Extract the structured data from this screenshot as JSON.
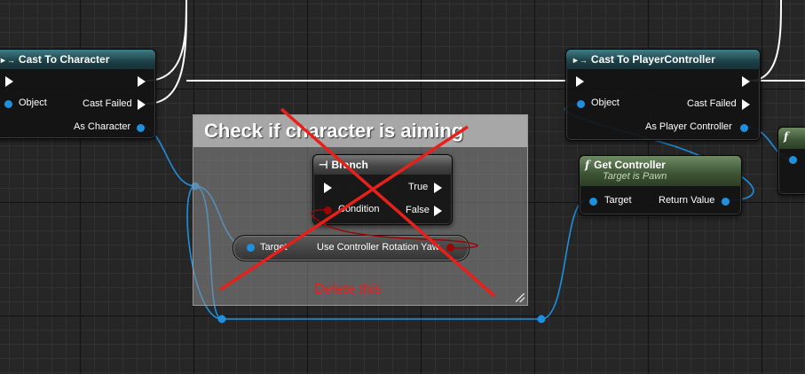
{
  "nodes": {
    "cast_character": {
      "title": "Cast To Character",
      "object_label": "Object",
      "cast_failed_label": "Cast Failed",
      "as_character_label": "As Character"
    },
    "cast_player_controller": {
      "title": "Cast To PlayerController",
      "object_label": "Object",
      "cast_failed_label": "Cast Failed",
      "as_player_controller_label": "As Player Controller"
    },
    "get_controller": {
      "title": "Get Controller",
      "subtitle": "Target is Pawn",
      "target_label": "Target",
      "return_label": "Return Value"
    },
    "branch": {
      "title": "Branch",
      "condition_label": "Condition",
      "true_label": "True",
      "false_label": "False"
    },
    "use_controller_rotation": {
      "target_label": "Target",
      "value_label": "Use Controller Rotation Yaw"
    },
    "partial_node": {
      "title": "f"
    }
  },
  "comment": {
    "title": "Check if character is aiming",
    "annotation": "Delete this"
  },
  "colors": {
    "graph_background": "#262626",
    "object_pin": "#1e90e0",
    "bool_pin": "#9a0606",
    "exec_wire": "#ffffff",
    "annotation_red": "#e8201a"
  }
}
